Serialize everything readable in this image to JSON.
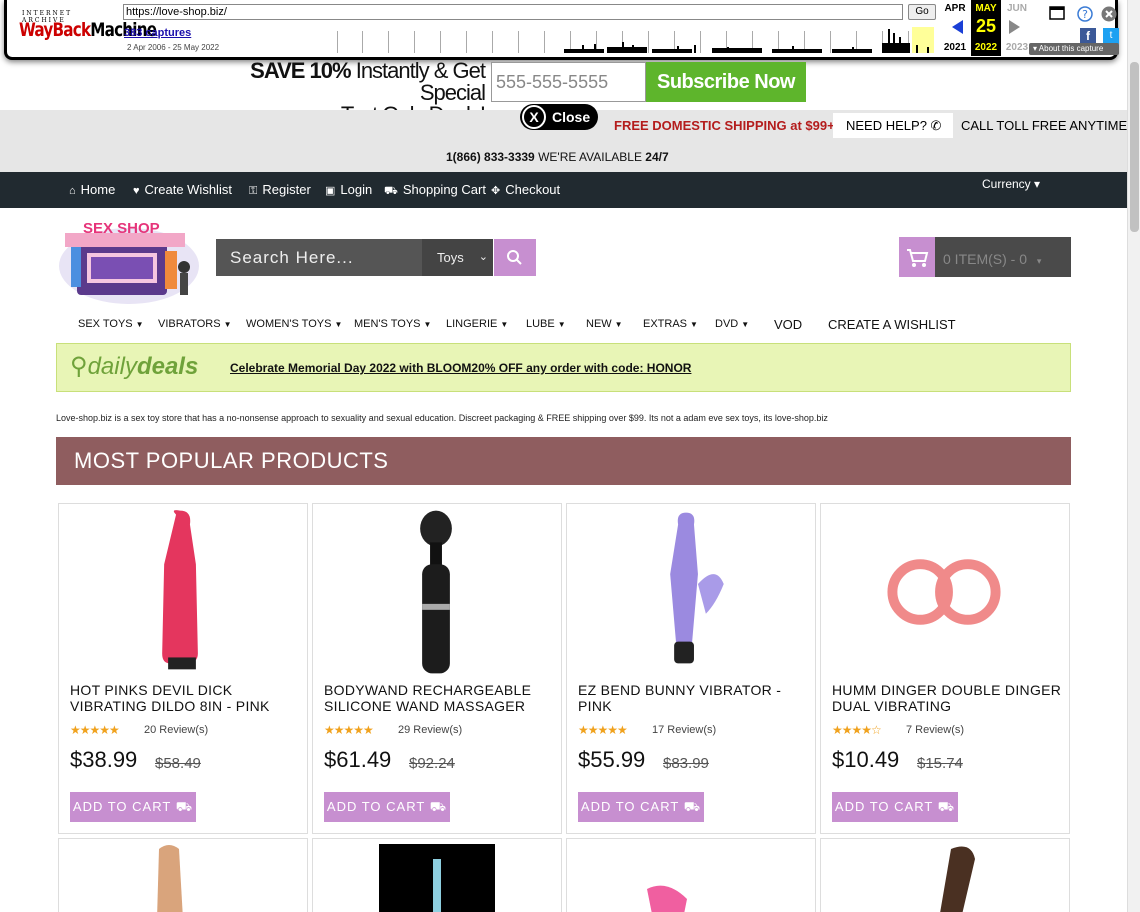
{
  "wayback": {
    "ia_label": "INTERNET ARCHIVE",
    "logo_text_red": "WayBack",
    "logo_text_black": "Machine",
    "url": "https://love-shop.biz/",
    "go_label": "Go",
    "captures": "383 captures",
    "date_range": "2 Apr 2006 - 25 May 2022",
    "months": {
      "prev": {
        "month": "APR",
        "year": "2021"
      },
      "current": {
        "month": "MAY",
        "day": "25",
        "year": "2022"
      },
      "next": {
        "month": "JUN",
        "year": "2023"
      }
    },
    "about": "About this capture"
  },
  "promo": {
    "save": "SAVE 10%",
    "line1_rest": " Instantly & Get Special",
    "line2": "Text Only Deals!",
    "phone_placeholder": "555-555-5555",
    "subscribe": "Subscribe Now",
    "close": "Close"
  },
  "topbar": {
    "free_shipping": "FREE DOMESTIC SHIPPING at $99+",
    "need_help": "NEED HELP?",
    "toll_free": "CALL TOLL FREE ANYTIME",
    "phone": "1(866) 833-3339",
    "available": " WE'RE AVAILABLE ",
    "hours": "24/7"
  },
  "nav": {
    "items": [
      "Home",
      "Create Wishlist",
      "Register",
      "Login",
      "Shopping Cart",
      "Checkout"
    ],
    "currency": "Currency"
  },
  "header": {
    "logo_text": "SEX SHOP",
    "search_placeholder": "Search Here...",
    "search_category": "Toys",
    "cart_label": "0 ITEM(S) - 0"
  },
  "categories": [
    "SEX TOYS",
    "VIBRATORS",
    "WOMEN'S TOYS",
    "MEN'S TOYS",
    "LINGERIE",
    "LUBE",
    "NEW",
    "EXTRAS",
    "DVD",
    "VOD",
    "CREATE A WISHLIST"
  ],
  "deals": {
    "logo_a": "daily",
    "logo_b": "deals",
    "text": "Celebrate Memorial Day 2022 with BLOOM20% OFF any order with code: HONOR"
  },
  "intro": "Love-shop.biz is a sex toy store that has a no-nonsense approach to sexuality and sexual education. Discreet packaging & FREE shipping over $99. Its not a adam eve sex toys, its love-shop.biz",
  "section_title": "MOST POPULAR PRODUCTS",
  "products": [
    {
      "name": "HOT PINKS DEVIL DICK VIBRATING DILDO 8IN - PINK",
      "stars": "★★★★★",
      "rating": 5,
      "reviews": "20 Review(s)",
      "price": "$38.99",
      "old_price": "$58.49",
      "cta": "ADD TO CART"
    },
    {
      "name": "BODYWAND RECHARGEABLE SILICONE WAND MASSAGER",
      "stars": "★★★★★",
      "rating": 5,
      "reviews": "29 Review(s)",
      "price": "$61.49",
      "old_price": "$92.24",
      "cta": "ADD TO CART"
    },
    {
      "name": "EZ BEND BUNNY VIBRATOR - PINK",
      "stars": "★★★★★",
      "rating": 5,
      "reviews": "17 Review(s)",
      "price": "$55.99",
      "old_price": "$83.99",
      "cta": "ADD TO CART"
    },
    {
      "name": "HUMM DINGER DOUBLE DINGER DUAL VIBRATING",
      "stars": "★★★★☆",
      "rating": 4,
      "reviews": "7 Review(s)",
      "price": "$10.49",
      "old_price": "$15.74",
      "cta": "ADD TO CART"
    }
  ]
}
